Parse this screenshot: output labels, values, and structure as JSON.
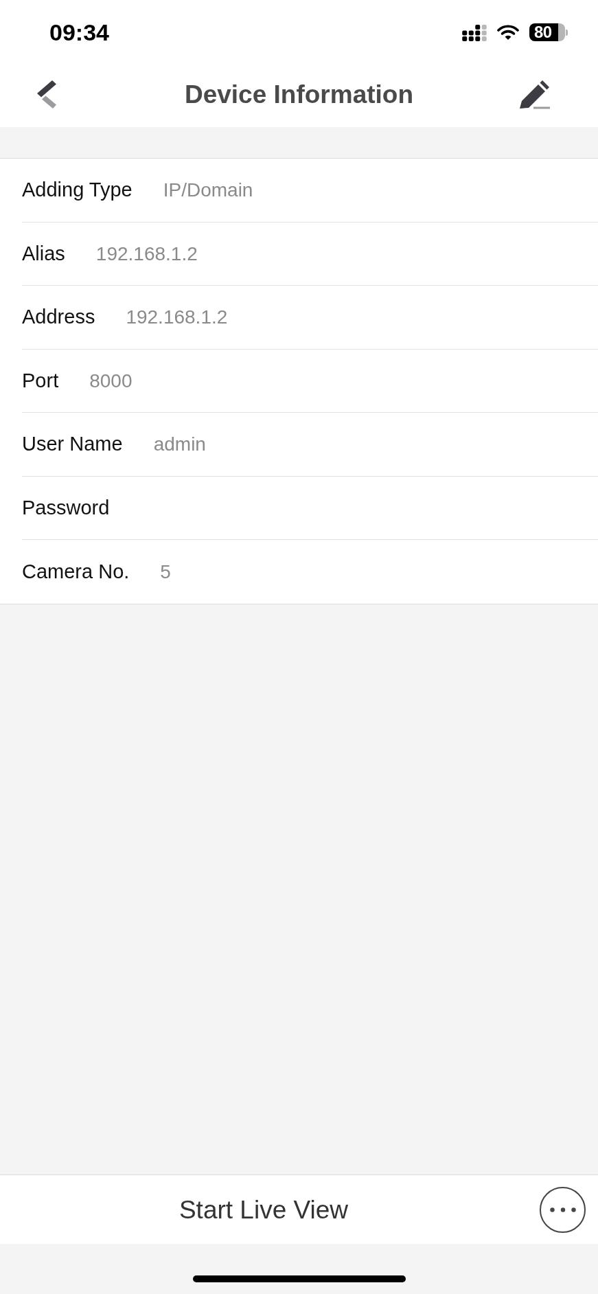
{
  "status_bar": {
    "time": "09:34",
    "battery": "80"
  },
  "nav_bar": {
    "title": "Device Information"
  },
  "fields": [
    {
      "label": "Adding Type",
      "value": "IP/Domain"
    },
    {
      "label": "Alias",
      "value": "192.168.1.2"
    },
    {
      "label": "Address",
      "value": "192.168.1.2"
    },
    {
      "label": "Port",
      "value": "8000"
    },
    {
      "label": "User Name",
      "value": "admin"
    },
    {
      "label": "Password"
    },
    {
      "label": "Camera No.",
      "value": "5"
    }
  ],
  "bottom_bar": {
    "primary_button": "Start Live View"
  }
}
